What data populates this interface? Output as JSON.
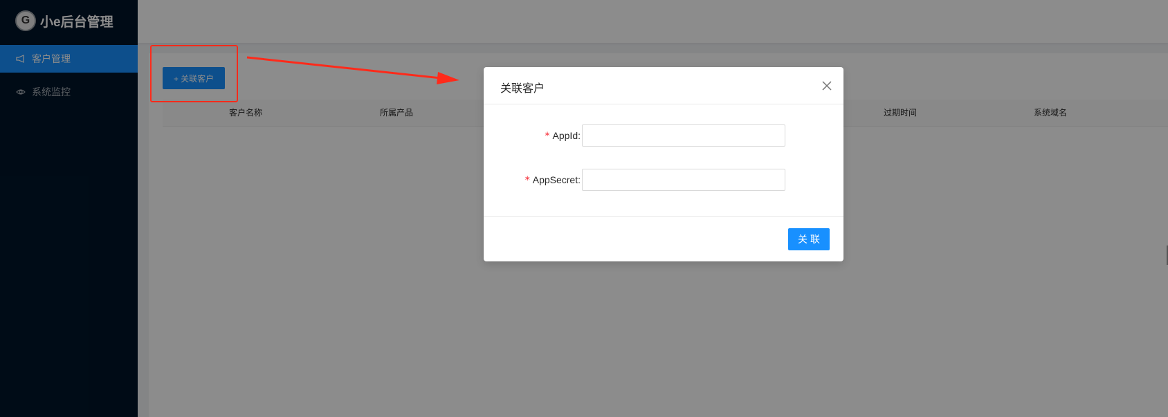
{
  "app": {
    "logo_mark": "G",
    "logo_text": "小e后台管理"
  },
  "sidebar": {
    "items": [
      {
        "label": "客户管理",
        "icon": "notification-icon",
        "active": true
      },
      {
        "label": "系统监控",
        "icon": "eye-icon",
        "active": false
      }
    ]
  },
  "toolbar": {
    "add_label": "+ 关联客户"
  },
  "table": {
    "columns": [
      "客户名称",
      "所属产品",
      "过期时间",
      "系统域名"
    ]
  },
  "modal": {
    "title": "关联客户",
    "fields": [
      {
        "required_mark": "*",
        "label": "AppId:",
        "value": "",
        "placeholder": ""
      },
      {
        "required_mark": "*",
        "label": "AppSecret:",
        "value": "",
        "placeholder": ""
      }
    ],
    "ok_label": "关联"
  },
  "colors": {
    "sidebar_bg": "#001529",
    "primary": "#1890ff",
    "required": "#f5222d",
    "annotation": "#ff2a1a"
  }
}
